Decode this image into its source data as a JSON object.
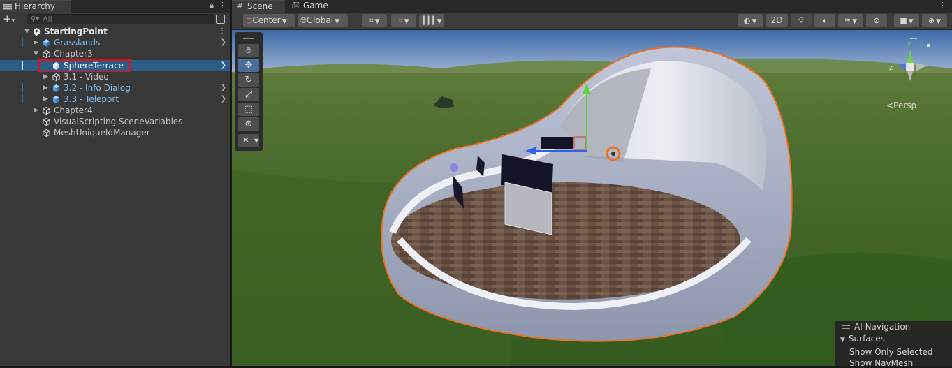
{
  "hierarchy": {
    "tab_label": "Hierarchy",
    "search_placeholder": "All",
    "rows": [
      {
        "label": "StartingPoint"
      },
      {
        "label": "Grasslands"
      },
      {
        "label": "Chapter3"
      },
      {
        "label": "SphereTerrace"
      },
      {
        "label": "3.1 - Video"
      },
      {
        "label": "3.2 - Info Dialog"
      },
      {
        "label": "3.3 - Teleport"
      },
      {
        "label": "Chapter4"
      },
      {
        "label": "VisualScripting SceneVariables"
      },
      {
        "label": "MeshUniqueIdManager"
      }
    ]
  },
  "scene": {
    "tabs": [
      {
        "label": "Scene"
      },
      {
        "label": "Game"
      }
    ],
    "toolbar": {
      "pivot": "Center",
      "space": "Global",
      "mode_2d": "2D"
    },
    "gizmo": {
      "axis_y": "y",
      "axis_z": "z",
      "projection": "Persp"
    },
    "ai_navigation": {
      "title": "AI Navigation",
      "section": "Surfaces",
      "option_1": "Show Only Selected",
      "option_2": "Show NavMesh"
    }
  },
  "colors": {
    "selection_blue": "#2c5d87",
    "prefab_blue": "#7dbef2",
    "highlight_red": "#e0101a",
    "selection_outline": "#f07020"
  }
}
